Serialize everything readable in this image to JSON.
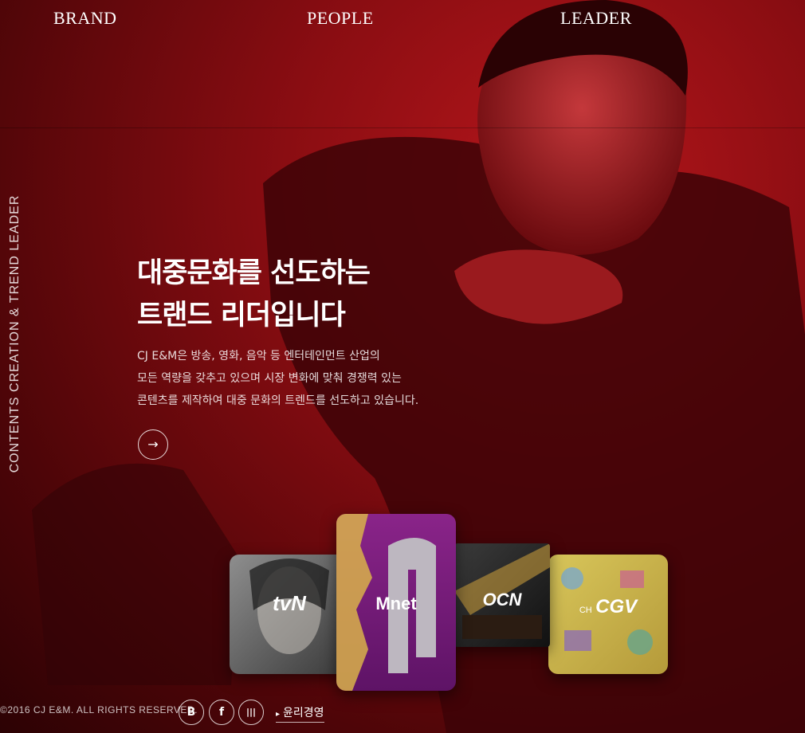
{
  "nav": {
    "items": [
      {
        "label": "BRAND"
      },
      {
        "label": "PEOPLE"
      },
      {
        "label": "LEADER"
      }
    ]
  },
  "side_text": "CONTENTS CREATION & TREND LEADER",
  "hero": {
    "headline": [
      "대중문화를 선도하는",
      "트랜드 리더입니다"
    ],
    "description": [
      "CJ E&M은 방송, 영화, 음악 등 엔터테인먼트 산업의",
      "모든 역량을 갖추고 있으며 시장 변화에 맞춰 경쟁력 있는",
      "콘텐츠를 제작하여 대중 문화의 트렌드를 선도하고 있습니다."
    ],
    "more_icon": "arrow-right-icon"
  },
  "channels": [
    {
      "name": "tvN"
    },
    {
      "name": "Mnet"
    },
    {
      "name": "OCN"
    },
    {
      "name": "CH CGV",
      "prefix": "CH",
      "main": "CGV"
    }
  ],
  "footer": {
    "copyright": "©2016 CJ E&M. ALL RIGHTS RESERVED.",
    "sns": [
      {
        "icon": "blog-icon",
        "glyph": "B"
      },
      {
        "icon": "facebook-icon",
        "glyph": "f"
      },
      {
        "icon": "barcode-icon",
        "glyph": "|||"
      }
    ],
    "ethics_label": "윤리경영",
    "ethics_marker": "▸"
  },
  "colors": {
    "primary_red": "#a3141a",
    "dark_red": "#4e0508",
    "mnet_purple": "#7a1a7c",
    "cgv_yellow": "#cdb94a"
  }
}
